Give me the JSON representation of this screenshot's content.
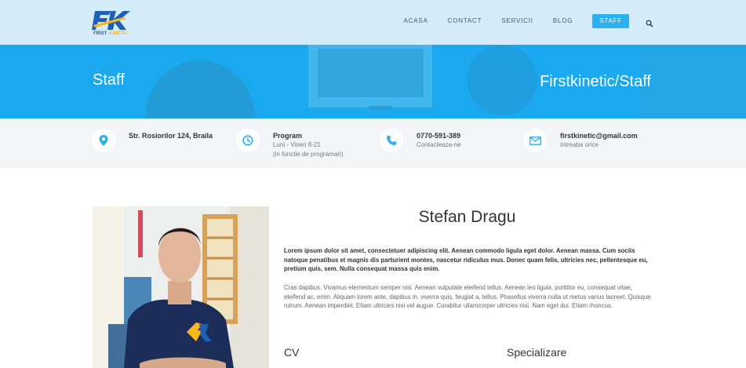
{
  "header": {
    "logo_text": "FIRST KINETIC",
    "nav": [
      {
        "label": "ACASA",
        "active": false
      },
      {
        "label": "CONTACT",
        "active": false
      },
      {
        "label": "SERVICII",
        "active": false
      },
      {
        "label": "BLOG",
        "active": false
      },
      {
        "label": "STAFF",
        "active": true
      }
    ],
    "search_icon": "search-icon"
  },
  "hero": {
    "title": "Staff",
    "breadcrumb": [
      "Firstkinetic",
      "/",
      "Staff"
    ]
  },
  "info": [
    {
      "icon": "map-pin-icon",
      "title": "Str. Rosiorilor 124, Braila",
      "lines": []
    },
    {
      "icon": "clock-icon",
      "title": "Program",
      "lines": [
        "Luni - Vineri 8-21",
        "(in functie de programari)"
      ]
    },
    {
      "icon": "phone-icon",
      "title": "0770-591-389",
      "lines": [
        "Contacteaza-ne"
      ]
    },
    {
      "icon": "envelope-icon",
      "title": "firstkinetic@gmail.com",
      "lines": [
        "Intreaba orice"
      ]
    }
  ],
  "profile": {
    "name": "Stefan Dragu",
    "lead": "Lorem ipsum dolor sit amet, consectetuer adipiscing elit. Aenean commodo ligula eget dolor. Aenean massa. Cum sociis natoque penatibus et magnis dis parturient montes, nascetur ridiculus mus. Donec quam felis, ultricies nec, pellentesque eu, pretium quis, sem. Nulla consequat massa quis enim.",
    "body": "Cras dapibus. Vivamus elementum semper nisi. Aenean vulputate eleifend tellus. Aenean leo ligula, porttitor eu, consequat vitae, eleifend ac, enim. Aliquam lorem ante, dapibus in, viverra quis, feugiat a, tellus. Phasellus viverra nulla ut metus varius laoreet. Quisque rutrum. Aenean imperdiet. Etiam ultricies nisi vel augue. Curabitur ullamcorper ultricies nisi. Nam eget dui. Etiam rhoncus.",
    "cv_heading": "CV",
    "spec_heading": "Specializare",
    "shirt_logo": "FIRST KINETIC"
  },
  "colors": {
    "accent": "#2bb0f0",
    "hero": "#1aa8ee",
    "topbar": "#d5ecfb",
    "infobar": "#f3f5f7"
  }
}
